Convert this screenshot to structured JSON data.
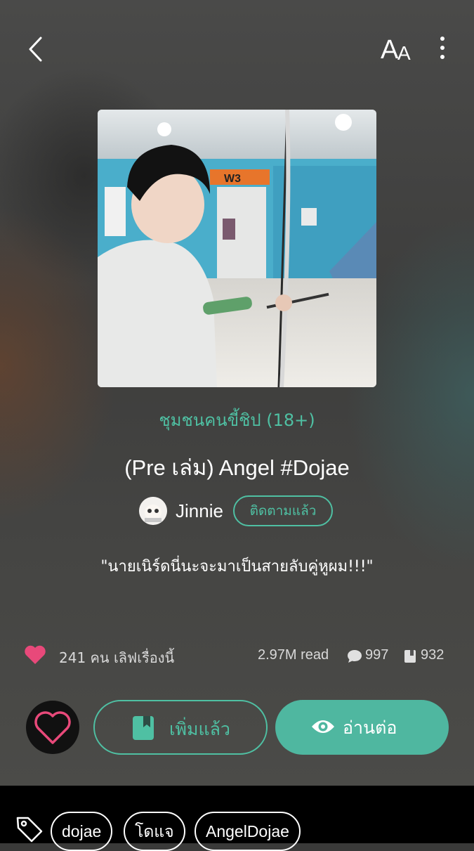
{
  "header": {
    "back_icon": "chevron-left-icon",
    "font_size_big": "A",
    "font_size_small": "A",
    "more_icon": "vertical-dots-icon"
  },
  "story": {
    "community": "ชุมชนคนขี้ชิป (18+)",
    "title": "(Pre เล่ม) Angel #Dojae",
    "author": "Jinnie",
    "follow_label": "ติดตามแล้ว",
    "tagline": "\"นายเนิร์ดนี่นะจะมาเป็นสายลับคู่หูผม!!!\""
  },
  "stats": {
    "love_text": "241 คน เลิฟเรื่องนี้",
    "reads": "2.97M read",
    "comments": "997",
    "bookmarks": "932"
  },
  "actions": {
    "added_label": "เพิ่มแล้ว",
    "read_label": "อ่านต่อ"
  },
  "tags": [
    "dojae",
    "โดแจ",
    "AngelDojae"
  ],
  "colors": {
    "accent": "#4fc0a3",
    "heart": "#e8497a",
    "read_button": "#4fb7a0"
  }
}
